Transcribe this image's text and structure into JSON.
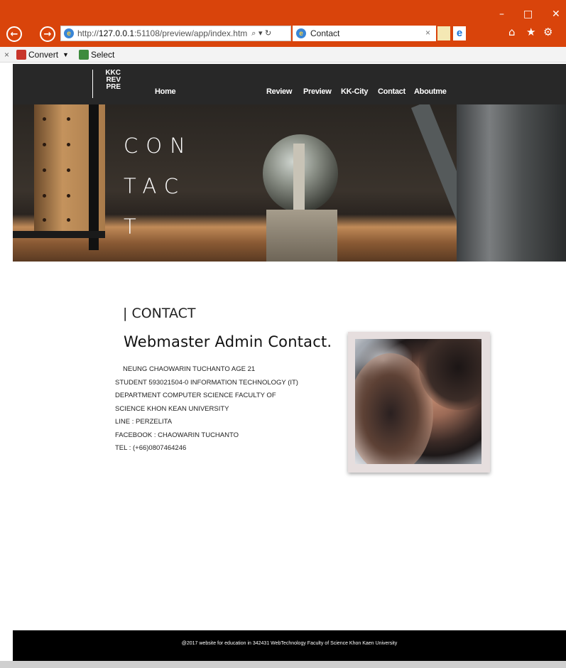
{
  "browser": {
    "address_scheme": "http://",
    "address_host": "127.0.0.1",
    "address_path": ":51108/preview/app/index.htm",
    "address_tools": "⌕ ▾ ↻",
    "tab_title": "Contact",
    "tab_close": "×",
    "ie_glyph": "e",
    "edge_glyph": "e",
    "back_glyph": "←",
    "forward_glyph": "→",
    "minimize_glyph": "–",
    "maximize_glyph": "□",
    "close_glyph": "✕",
    "home_glyph": "⌂",
    "favorites_glyph": "★",
    "settings_glyph": "⚙",
    "accent_color": "#d9440b"
  },
  "command_bar": {
    "close_label": "×",
    "convert_label": "Convert",
    "convert_caret": "▼",
    "select_label": "Select"
  },
  "site": {
    "logo_lines": [
      "KKC",
      "REV",
      "PRE"
    ],
    "nav": {
      "home": "Home",
      "review": "Review",
      "preview": "Preview",
      "kk_city": "KK-City",
      "contact": "Contact",
      "aboutme": "Aboutme"
    },
    "hero_title": "CONTACT"
  },
  "main": {
    "section_label": "| CONTACT",
    "title": "Webmaster Admin Contact.",
    "info_lines": [
      "NEUNG CHAOWARIN TUCHANTO AGE 21",
      "STUDENT 593021504-0 INFORMATION TECHNOLOGY (IT)",
      "DEPARTMENT COMPUTER SCIENCE FACULTY OF",
      "SCIENCE KHON KEAN UNIVERSITY",
      "LINE : PERZELITA",
      "FACEBOOK : CHAOWARIN TUCHANTO",
      "TEL : (+66)0807464246"
    ]
  },
  "footer": {
    "text": "@2017 website for education in 342431 WebTechnology Faculty of Science Khon Kaen University"
  }
}
